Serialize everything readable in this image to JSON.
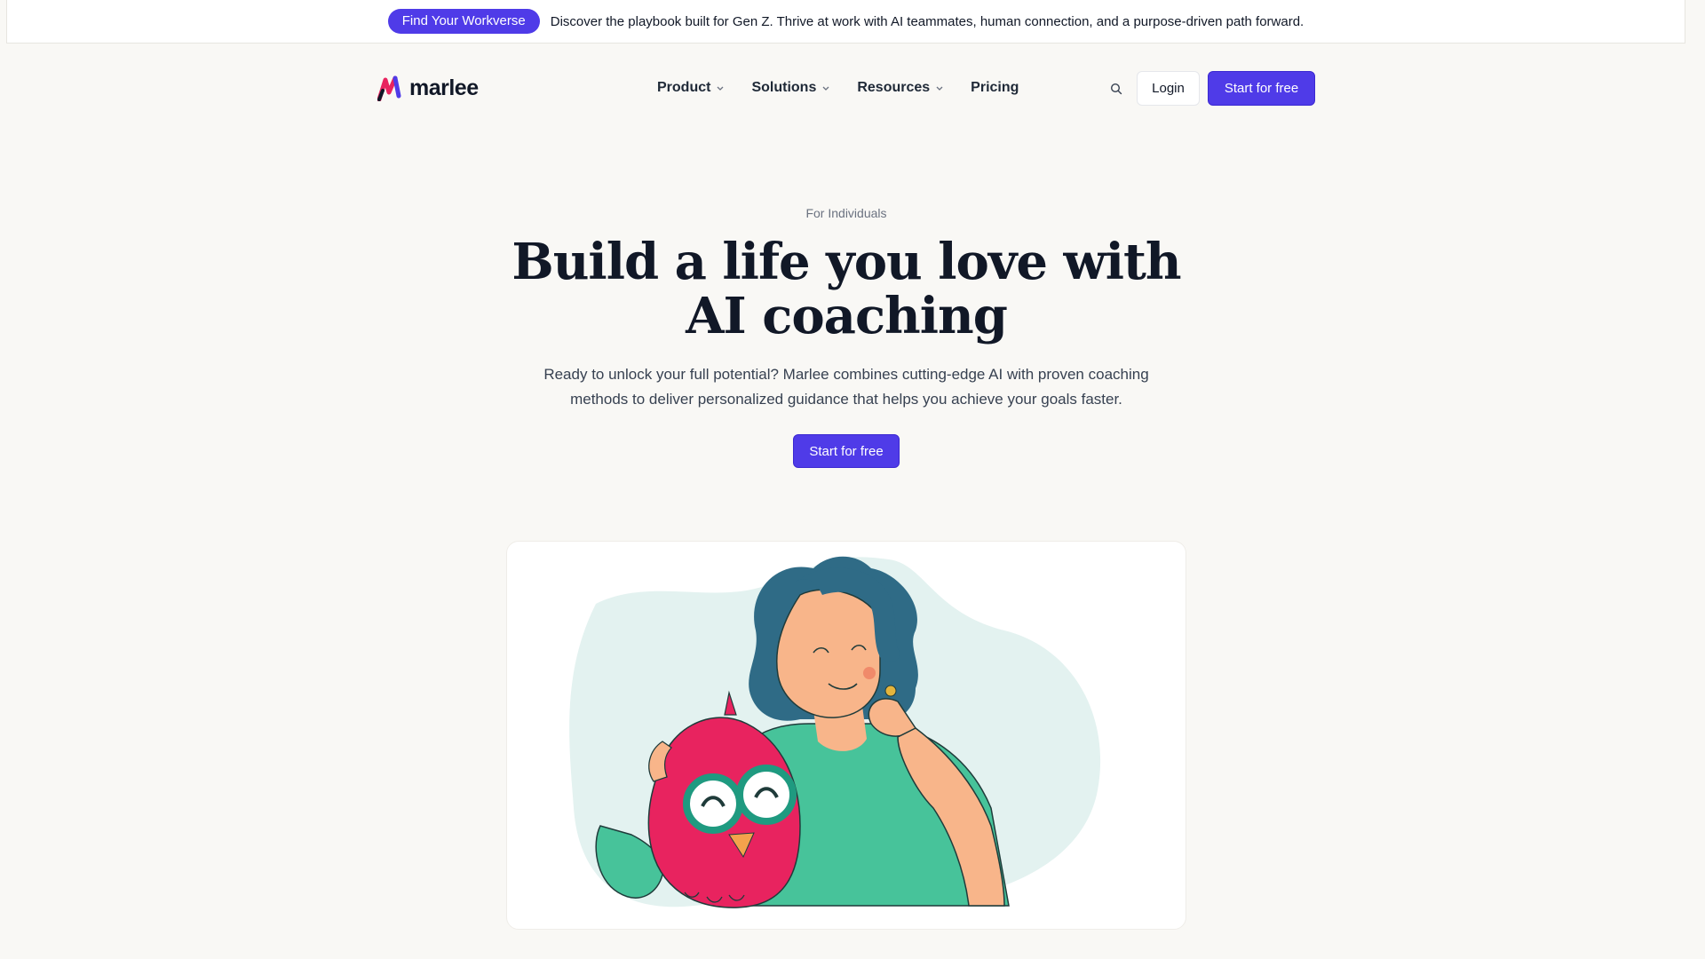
{
  "announcement": {
    "pill_label": "Find Your Workverse",
    "text": "Discover the playbook built for Gen Z. Thrive at work with AI teammates, human connection, and a purpose-driven path forward."
  },
  "header": {
    "logo_text": "marlee",
    "nav": [
      {
        "label": "Product",
        "has_dropdown": true
      },
      {
        "label": "Solutions",
        "has_dropdown": true
      },
      {
        "label": "Resources",
        "has_dropdown": true
      },
      {
        "label": "Pricing",
        "has_dropdown": false
      }
    ],
    "search_icon": "search-icon",
    "login_label": "Login",
    "cta_label": "Start for free"
  },
  "hero": {
    "eyebrow": "For Individuals",
    "title": "Build a life you love with AI coaching",
    "subtitle": "Ready to unlock your full potential? Marlee combines cutting-edge AI with proven coaching methods to deliver personalized guidance that helps you achieve your goals faster.",
    "cta_label": "Start for free"
  },
  "colors": {
    "brand": "#4f3be8",
    "background": "#f9f8f5",
    "blob": "#e3f2f0",
    "owl": "#e8235f",
    "shirt": "#47c39a",
    "hair": "#2f6b86",
    "skin": "#f8b58a"
  }
}
